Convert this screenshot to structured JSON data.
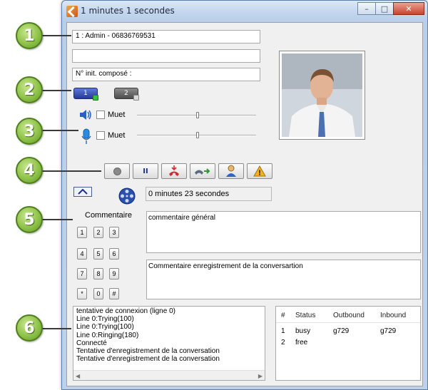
{
  "window": {
    "title": "1 minutes 1 secondes",
    "buttons": {
      "minimize": "–",
      "maximize": "□",
      "close": "✕"
    }
  },
  "fields": {
    "caller": "1 : Admin  - 06836769531",
    "empty": "",
    "initial_number": "N° init. composé :"
  },
  "lines": [
    {
      "label": "1",
      "active": true,
      "color": "#2a43a8",
      "led": "#3cbf3c"
    },
    {
      "label": "2",
      "active": false,
      "color": "#5c5c5c",
      "led": "#d9d9d9"
    }
  ],
  "audio": {
    "speaker": {
      "label": "Muet",
      "checked": false,
      "level": 0.57
    },
    "microphone": {
      "label": "Muet",
      "checked": false,
      "level": 0.57
    }
  },
  "toolbar": {
    "icons": [
      "record-icon",
      "pause-icon",
      "hangup-icon",
      "transfer-icon",
      "contact-icon",
      "warning-icon"
    ],
    "pause_label": "II",
    "warning_label": "!"
  },
  "duration": "0 minutes 23 secondes",
  "comments": {
    "label": "Commentaire",
    "general": "commentaire général",
    "recording": "Commentaire enregistrement de la conversartion"
  },
  "keypad": [
    "1",
    "2",
    "3",
    "4",
    "5",
    "6",
    "7",
    "8",
    "9",
    "*",
    "0",
    "#"
  ],
  "log": [
    "tentative de connexion (ligne 0)",
    "Line 0:Trying(100)",
    "Line 0:Trying(100)",
    "Line 0:Ringing(180)",
    "Connecté",
    "Tentative d'enregistrement de la conversation",
    "Tentative d'enregistrement de la conversation"
  ],
  "status_table": {
    "headers": [
      "#",
      "Status",
      "Outbound",
      "Inbound"
    ],
    "rows": [
      [
        "1",
        "busy",
        "g729",
        "g729"
      ],
      [
        "2",
        "free",
        "",
        ""
      ]
    ]
  },
  "callouts": [
    "1",
    "2",
    "3",
    "4",
    "5",
    "6"
  ],
  "colors": {
    "callout_green": "#8fc24a",
    "window_frame": "#b9cfe8",
    "accent_blue": "#2a43a8"
  }
}
